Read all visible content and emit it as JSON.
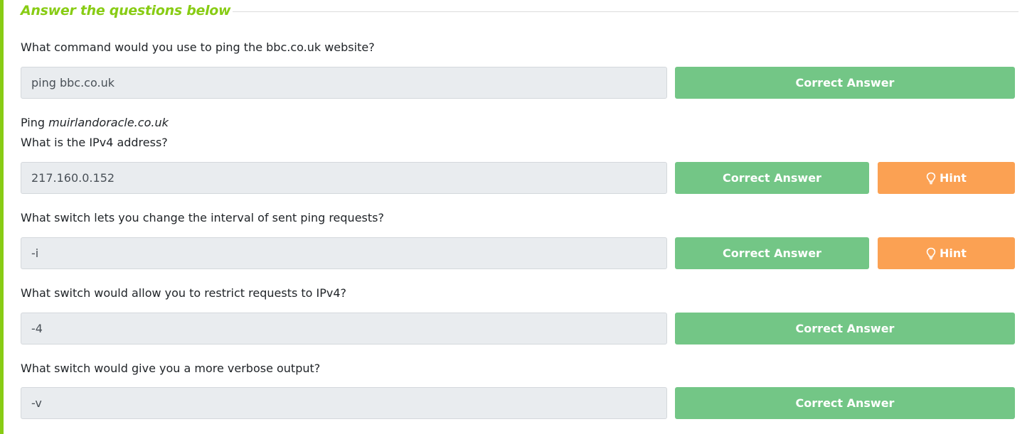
{
  "section": {
    "heading": "Answer the questions below"
  },
  "questions": [
    {
      "text": "What command would you use to ping the bbc.co.uk website?",
      "answer": "ping bbc.co.uk",
      "submit_label": "Correct Answer",
      "has_hint": false
    },
    {
      "text_prefix": "Ping ",
      "text_emphasis": "muirlandoracle.co.uk",
      "text_line2": "What is the IPv4 address?",
      "answer": "217.160.0.152",
      "submit_label": "Correct Answer",
      "has_hint": true,
      "hint_label": "Hint",
      "hint_icon": "lightbulb-icon"
    },
    {
      "text": "What switch lets you change the interval of sent ping requests?",
      "answer": "-i",
      "submit_label": "Correct Answer",
      "has_hint": true,
      "hint_label": "Hint",
      "hint_icon": "lightbulb-icon"
    },
    {
      "text": "What switch would allow you to restrict requests to IPv4?",
      "answer": "-4",
      "submit_label": "Correct Answer",
      "has_hint": false
    },
    {
      "text": "What switch would give you a more verbose output?",
      "answer": "-v",
      "submit_label": "Correct Answer",
      "has_hint": false
    }
  ],
  "colors": {
    "accent_green": "#88cc14",
    "correct_button": "#73c686",
    "hint_button": "#fba153",
    "input_background": "#e9ecef"
  }
}
